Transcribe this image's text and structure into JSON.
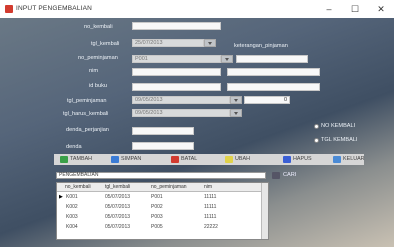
{
  "window": {
    "title": "INPUT PENGEMBALIAN"
  },
  "form": {
    "labels": {
      "no_kembali": "no_kembali",
      "tgl_kembali": "tgl_kembali",
      "no_peminjaman": "no_peminjaman",
      "nim": "nim",
      "id_buku": "id buku",
      "tgl_peminjaman": "tgl_peminjaman",
      "tgl_harus_kembali": "tgl_harus_kembali",
      "denda_perjanjian": "denda_perjanjian",
      "denda": "denda",
      "keterangan_pinjaman": "keterangan_pinjaman"
    },
    "values": {
      "tgl_kembali": "25/07/2013",
      "no_peminjaman": "P001",
      "tgl_peminjaman": "09/05/2013",
      "tgl_harus_kembali": "09/05/2013",
      "jumlah": "0"
    },
    "radios": {
      "no_kembali": "NO KEMBALI",
      "tgl_kembali": "TGL KEMBALI"
    }
  },
  "toolbar": {
    "tambah": "TAMBAH",
    "simpan": "SIMPAN",
    "batal": "BATAL",
    "ubah": "UBAH",
    "hapus": "HAPUS",
    "keluar": "KELUAR"
  },
  "search": {
    "value": "PENGEMBALIAN",
    "cari_label": "CARI"
  },
  "table": {
    "headers": [
      "no_kembali",
      "tgl_kembali",
      "no_peminjaman",
      "nim"
    ],
    "rows": [
      [
        "K001",
        "05/07/2013",
        "P001",
        "11111"
      ],
      [
        "K002",
        "05/07/2013",
        "P002",
        "11111"
      ],
      [
        "K003",
        "05/07/2013",
        "P003",
        "11111"
      ],
      [
        "K004",
        "05/07/2013",
        "P005",
        "22222"
      ]
    ]
  },
  "colors": {
    "accent": "#d23b2f",
    "toolbar_bg": "#d6d6d6"
  }
}
